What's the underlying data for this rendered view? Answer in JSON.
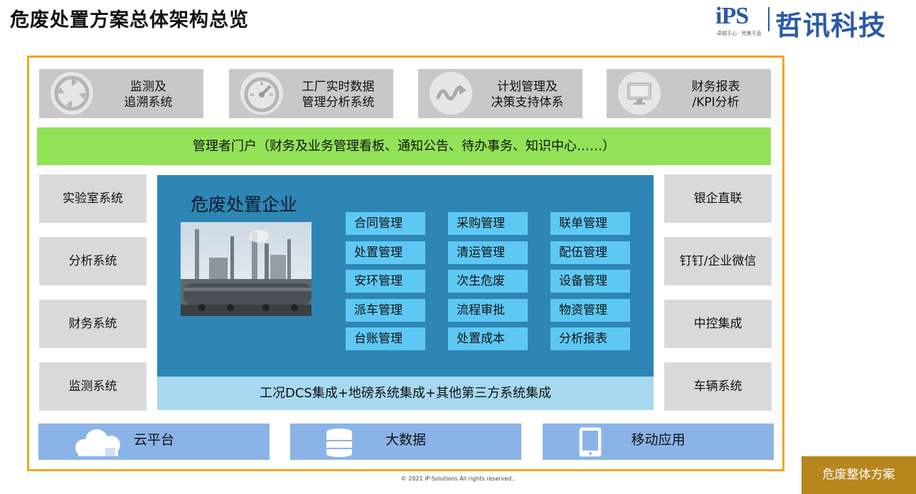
{
  "title": "危废处置方案总体架构总览",
  "logo": {
    "mark": "iPS",
    "tagline": "卓越于心 · 完美于品",
    "name": "哲讯科技"
  },
  "top_systems": [
    {
      "label": "监测及\n追溯系统",
      "icon": "recycle-arrows-icon"
    },
    {
      "label": "工厂实时数据\n管理分析系统",
      "icon": "speedometer-icon"
    },
    {
      "label": "计划管理及\n决策支持体系",
      "icon": "wave-arrow-icon"
    },
    {
      "label": "财务报表\n/KPI分析",
      "icon": "monitor-icon"
    }
  ],
  "portal": "管理者门户（财务及业务管理看板、通知公告、待办事务、知识中心……）",
  "left_systems": [
    "实验室系统",
    "分析系统",
    "财务系统",
    "监测系统"
  ],
  "right_systems": [
    "银企直联",
    "钉钉/企业微信",
    "中控集成",
    "车辆系统"
  ],
  "center": {
    "title": "危废处置企业",
    "modules": [
      [
        "合同管理",
        "采购管理",
        "联单管理"
      ],
      [
        "处置管理",
        "清运管理",
        "配伍管理"
      ],
      [
        "安环管理",
        "次生危废",
        "设备管理"
      ],
      [
        "派车管理",
        "流程审批",
        "物资管理"
      ],
      [
        "台账管理",
        "处置成本",
        "分析报表"
      ]
    ]
  },
  "integration": "工况DCS集成+地磅系统集成+其他第三方系统集成",
  "bottom": [
    {
      "label": "云平台",
      "icon": "cloud-icon"
    },
    {
      "label": "大数据",
      "icon": "database-icon"
    },
    {
      "label": "移动应用",
      "icon": "tablet-icon"
    }
  ],
  "copyright": "© 2021  iP-Solutions All rights reserved..",
  "footer_badge": "危废整体方案",
  "colors": {
    "frame": "#f0a71e",
    "portal": "#92e257",
    "center": "#2e86b5",
    "module": "#5ec8f5",
    "integration": "#a6d9ef",
    "bottom": "#8ab4e8",
    "badge": "#b7861c"
  }
}
